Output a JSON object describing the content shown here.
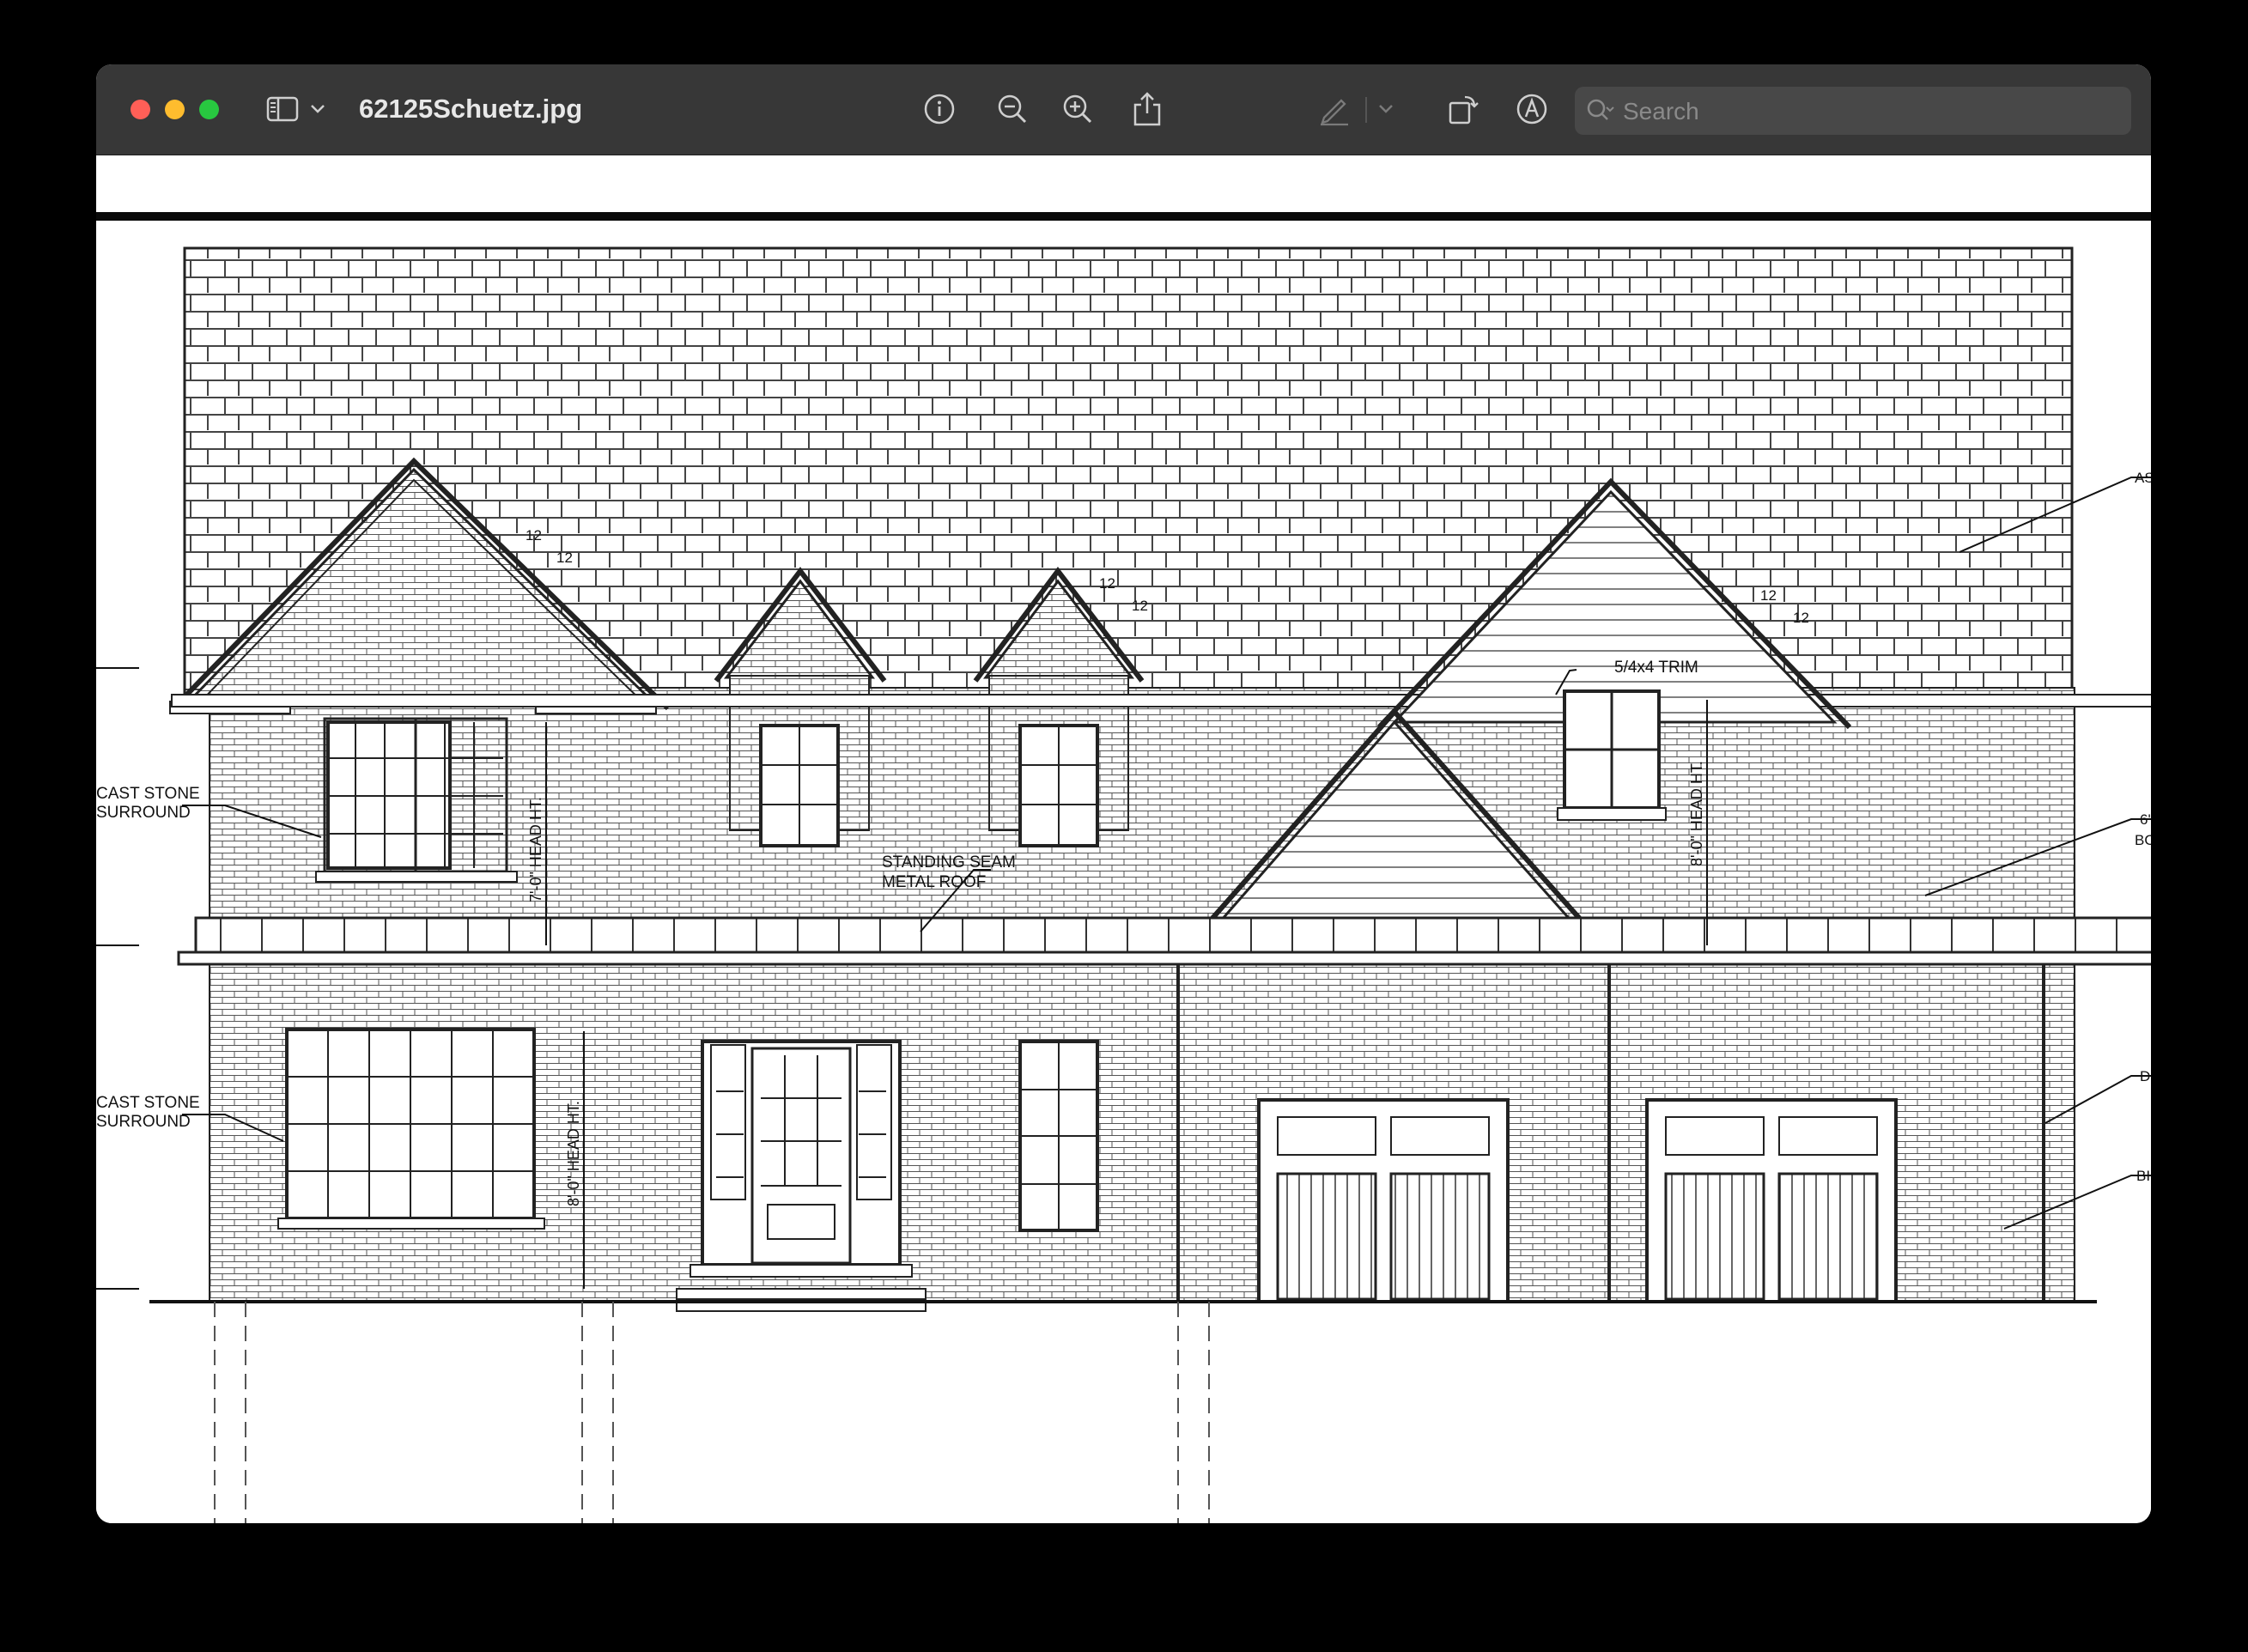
{
  "window": {
    "title": "62125Schuetz.jpg"
  },
  "toolbar": {
    "search_placeholder": "Search",
    "icons": [
      "sidebar-icon",
      "chevron-down-icon",
      "info-icon",
      "zoom-out-icon",
      "zoom-in-icon",
      "share-icon",
      "markup-pen-icon",
      "chevron-down-icon",
      "rotate-icon",
      "markup-icon",
      "signature-icon",
      "search-icon"
    ]
  },
  "drawing": {
    "labels": {
      "cast_stone_1": "CAST STONE",
      "surround_1": "SURROUND",
      "cast_stone_2": "CAST STONE",
      "surround_2": "SURROUND",
      "standing_seam": "STANDING SEAM",
      "metal_roof": "METAL ROOF",
      "trim": "5/4x4 TRIM",
      "head_ht_7": "7'-0\" HEAD HT.",
      "head_ht_8a": "8'-0\" HEAD HT.",
      "head_ht_8b": "8'-0\" HEAD HT.",
      "pitch_1a": "12",
      "pitch_1b": "12",
      "pitch_2a": "12",
      "pitch_2b": "12",
      "pitch_3a": "12",
      "pitch_3b": "12",
      "right_as": "AS",
      "right_6": "6'",
      "right_bo": "BO",
      "right_d": "D",
      "right_b": "BI"
    }
  }
}
